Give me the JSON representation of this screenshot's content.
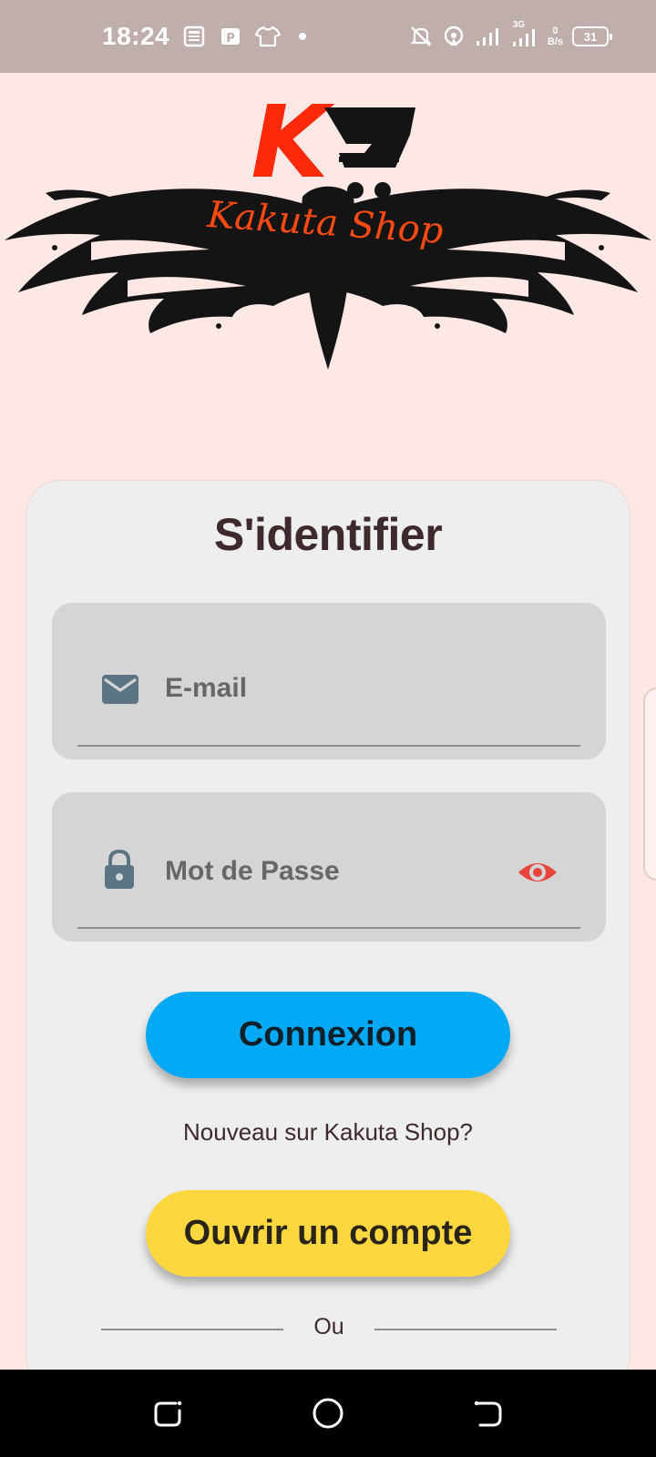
{
  "status_bar": {
    "time": "18:24",
    "network_type": "3G",
    "speed_value": "0",
    "speed_unit": "B/s",
    "battery": "31"
  },
  "logo": {
    "letter": "K",
    "brand_name": "Kakuta Shop",
    "colors": {
      "letter": "#ff2a0a",
      "brand": "#ff4a12",
      "ink": "#141414"
    }
  },
  "login": {
    "title": "S'identifier",
    "email_placeholder": "E-mail",
    "password_placeholder": "Mot de Passe",
    "login_button": "Connexion",
    "register_prompt": "Nouveau sur Kakuta Shop?",
    "register_button": "Ouvrir un compte",
    "divider_text": "Ou"
  },
  "icons": {
    "email": "mail-icon",
    "password": "lock-icon",
    "visibility": "eye-icon"
  },
  "theme": {
    "background": "#fde8e6",
    "card": "#eeeeee",
    "primary_button": "#03a9f4",
    "secondary_button": "#fdd73f",
    "eye_icon": "#e8453c"
  }
}
